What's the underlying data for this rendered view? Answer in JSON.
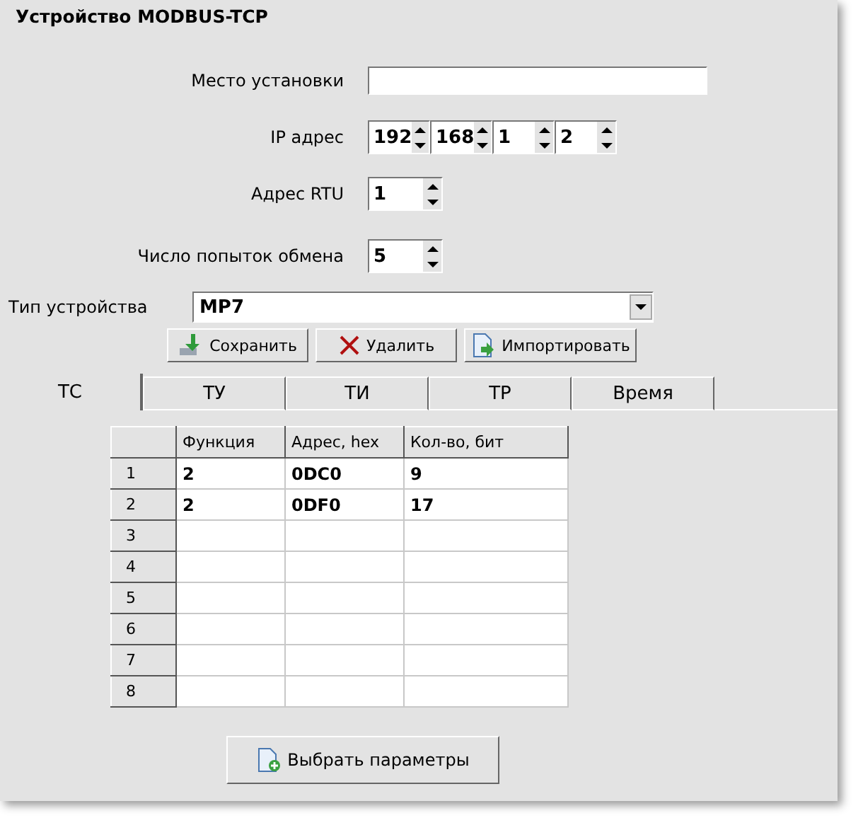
{
  "title": "Устройство MODBUS-TCP",
  "install_place": {
    "label": "Место установки"
  },
  "ip": {
    "label": "IP адрес",
    "octets": [
      "192",
      "168",
      "1",
      "2"
    ]
  },
  "rtu": {
    "label": "Адрес RTU",
    "value": "1"
  },
  "retries": {
    "label": "Число попыток обмена",
    "value": "5"
  },
  "device_type": {
    "label": "Тип устройства",
    "value": "MP7"
  },
  "buttons": [
    {
      "label": "Сохранить",
      "kind": "save"
    },
    {
      "label": "Удалить",
      "kind": "delete"
    },
    {
      "label": "Импортировать",
      "kind": "import"
    }
  ],
  "tabs": [
    {
      "label": "ТС",
      "selected": true
    },
    {
      "label": "ТУ",
      "selected": false
    },
    {
      "label": "ТИ",
      "selected": false
    },
    {
      "label": "ТР",
      "selected": false
    },
    {
      "label": "Время",
      "selected": false
    }
  ],
  "table": {
    "columns": [
      "Функция",
      "Адрес, hex",
      "Кол-во, бит"
    ],
    "rows": [
      {
        "number": "1",
        "cells": [
          "2",
          "0DC0",
          "9"
        ]
      },
      {
        "number": "2",
        "cells": [
          "2",
          "0DF0",
          "17"
        ]
      },
      {
        "number": "3",
        "cells": []
      },
      {
        "number": "4",
        "cells": []
      },
      {
        "number": "5",
        "cells": []
      },
      {
        "number": "6",
        "cells": []
      },
      {
        "number": "7",
        "cells": []
      },
      {
        "number": "8",
        "cells": []
      }
    ]
  },
  "select_button": {
    "label": "Выбрать параметры"
  }
}
